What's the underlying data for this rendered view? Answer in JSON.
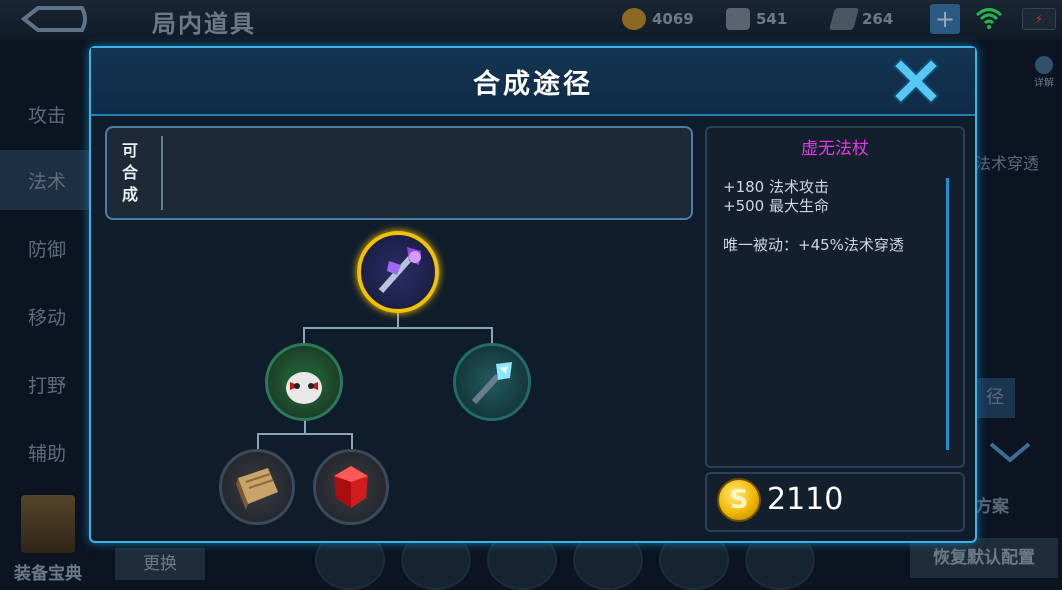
{
  "topbar": {
    "page_title": "局内道具",
    "gold": "4069",
    "diamond": "541",
    "tickets": "264"
  },
  "sidebar": {
    "items": [
      {
        "label": "攻击",
        "active": false
      },
      {
        "label": "法术",
        "active": true
      },
      {
        "label": "防御",
        "active": false
      },
      {
        "label": "移动",
        "active": false
      },
      {
        "label": "打野",
        "active": false
      },
      {
        "label": "辅助",
        "active": false
      }
    ],
    "equip_book_label": "装备宝典"
  },
  "background": {
    "swap_label": "更换",
    "detail_label": "详解",
    "partial_text_1": "法术穿透",
    "partial_text_2": "径",
    "partial_text_3": "方案",
    "reset_label": "恢复默认配置"
  },
  "dialog": {
    "title": "合成途径",
    "craftable_label": "可合成",
    "item": {
      "name": "虚无法杖",
      "stats": [
        "+180 法术攻击",
        "+500 最大生命"
      ],
      "passive": "唯一被动：+45%法术穿透",
      "price": "2110"
    }
  },
  "icons": {
    "coin_symbol": "S",
    "close_symbol": "✕",
    "plus_symbol": "+"
  },
  "colors": {
    "accent": "#3fb3e6",
    "item_name": "#e23be6",
    "gold_ring": "#f2c200"
  }
}
